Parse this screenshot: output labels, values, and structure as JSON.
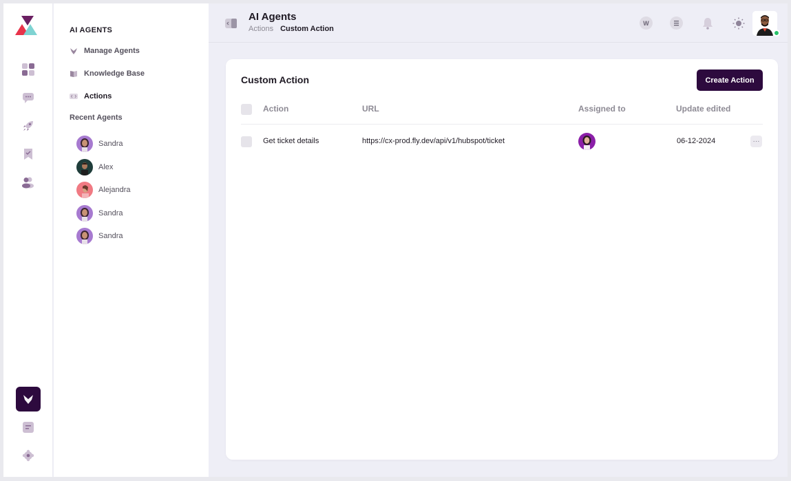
{
  "header": {
    "title": "AI Agents",
    "breadcrumbs": [
      "Actions",
      "Custom Action"
    ],
    "workspace_initial": "W"
  },
  "rail": {
    "items": [
      "dashboard-icon",
      "chat-icon",
      "rocket-icon",
      "bookmark-icon",
      "users-icon",
      "agents-icon",
      "notes-icon",
      "settings-icon"
    ],
    "active_item": "agents-icon"
  },
  "sidebar": {
    "section_title": "AI AGENTS",
    "items": [
      {
        "label": "Manage Agents",
        "icon": "agent-icon"
      },
      {
        "label": "Knowledge Base",
        "icon": "book-icon"
      },
      {
        "label": "Actions",
        "icon": "code-icon"
      }
    ],
    "active_item": "Actions",
    "recent_title": "Recent Agents",
    "recent_agents": [
      {
        "name": "Sandra"
      },
      {
        "name": "Alex"
      },
      {
        "name": "Alejandra"
      },
      {
        "name": "Sandra"
      },
      {
        "name": "Sandra"
      }
    ]
  },
  "card": {
    "title": "Custom Action",
    "create_button": "Create Action",
    "columns": [
      "Action",
      "URL",
      "Assigned to",
      "Update edited"
    ],
    "rows": [
      {
        "action": "Get ticket details",
        "url": "https://cx-prod.fly.dev/api/v1/hubspot/ticket",
        "date": "06-12-2024"
      }
    ],
    "more_label": "···"
  },
  "colors": {
    "brand": "#2d0a3e",
    "online": "#27c26a",
    "logo_red": "#e8334a",
    "logo_teal": "#7fd3d2"
  }
}
